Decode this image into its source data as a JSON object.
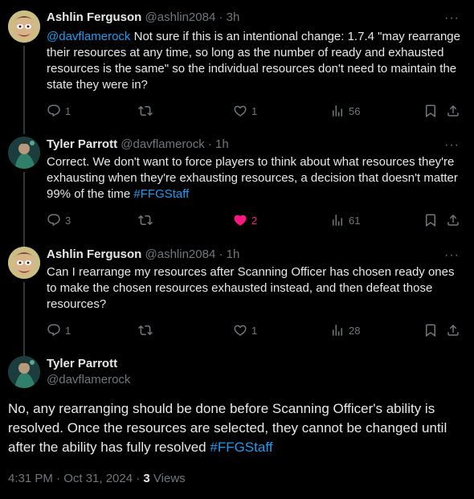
{
  "tweets": [
    {
      "name": "Ashlin Ferguson",
      "handle": "@ashlin2084",
      "sep": " · ",
      "time": "3h",
      "mention": "@davflamerock",
      "text": " Not sure if this is an intentional change: 1.7.4 \"may rearrange their resources at any time, so long as the number of ready and exhausted resources is the same\" so the individual resources don't need to maintain the state they were in?",
      "replies": "1",
      "retweets": "",
      "likes": "1",
      "views": "56"
    },
    {
      "name": "Tyler Parrott",
      "handle": "@davflamerock",
      "sep": " · ",
      "time": "1h",
      "text": "Correct. We don't want to force players to think about what resources they're exhausting when they're exhausting resources, a decision that doesn't matter 99% of the time ",
      "hashtag": "#FFGStaff",
      "replies": "3",
      "retweets": "",
      "likes": "2",
      "views": "61"
    },
    {
      "name": "Ashlin Ferguson",
      "handle": "@ashlin2084",
      "sep": " · ",
      "time": "1h",
      "text": "Can I rearrange my resources after Scanning Officer has chosen ready ones to make the chosen resources exhausted instead, and then defeat those resources?",
      "replies": "1",
      "retweets": "",
      "likes": "1",
      "views": "28"
    }
  ],
  "main_tweet": {
    "name": "Tyler Parrott",
    "handle": "@davflamerock",
    "text": "No, any rearranging should be done before Scanning Officer's ability is resolved. Once the resources are selected, they cannot be changed until after the ability has fully resolved ",
    "hashtag": "#FFGStaff",
    "timestamp": "4:31 PM · Oct 31, 2024 · ",
    "views_count": "3",
    "views_label": " Views"
  },
  "more_glyph": "···",
  "colors": {
    "link": "#1d9bf0",
    "liked": "#f91880",
    "muted": "#71767b",
    "line": "#333639"
  },
  "icons": [
    "reply-icon",
    "retweet-icon",
    "like-icon",
    "views-icon",
    "bookmark-icon",
    "share-icon",
    "more-icon"
  ]
}
